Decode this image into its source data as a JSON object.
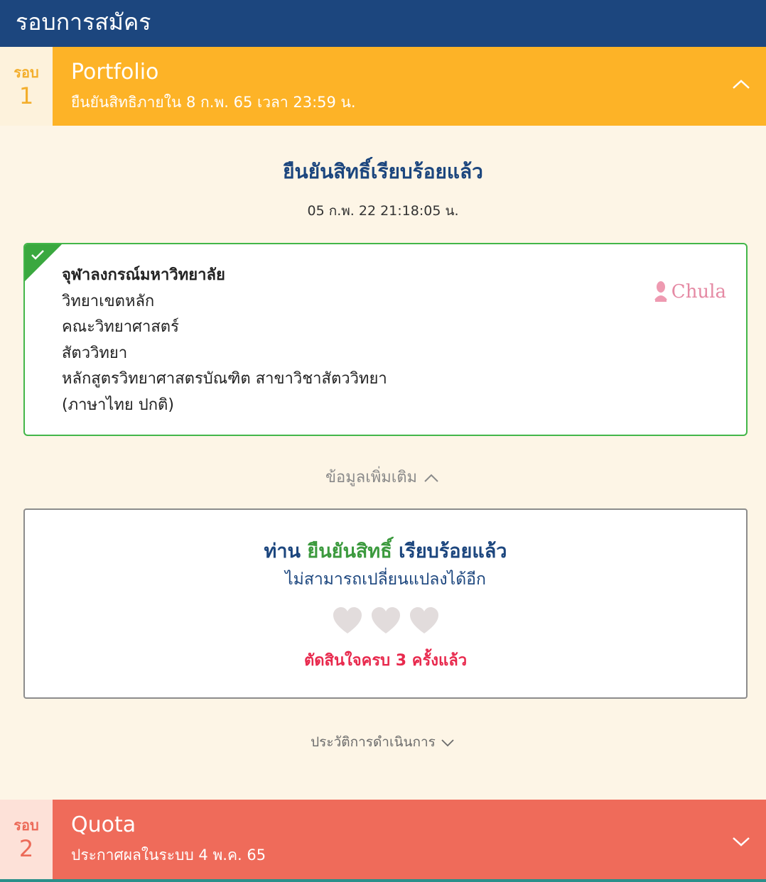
{
  "header": {
    "title": "รอบการสมัคร"
  },
  "rounds": [
    {
      "word": "รอบ",
      "number": "1",
      "name": "Portfolio",
      "subtitle": "ยืนยันสิทธิภายใน 8 ก.พ. 65 เวลา 23:59 น.",
      "state_icon": "chevron-up-icon",
      "color": "#fdb327"
    },
    {
      "word": "รอบ",
      "number": "2",
      "name": "Quota",
      "subtitle": "ประกาศผลในระบบ 4 พ.ค. 65",
      "state_icon": "chevron-down-icon",
      "color": "#ef6b5a"
    }
  ],
  "confirmation": {
    "title": "ยืนยันสิทธิ์เรียบร้อยแล้ว",
    "timestamp": "05 ก.พ. 22 21:18:05 น."
  },
  "choice": {
    "university": "จุฬาลงกรณ์มหาวิทยาลัย",
    "campus": "วิทยาเขตหลัก",
    "faculty": "คณะวิทยาศาสตร์",
    "department": "สัตววิทยา",
    "program": "หลักสูตรวิทยาศาสตรบัณฑิต สาขาวิชาสัตววิทยา",
    "program_type": "(ภาษาไทย ปกติ)",
    "logo_text": "Chula"
  },
  "more_info": {
    "label": "ข้อมูลเพิ่มเติม"
  },
  "status": {
    "prefix": "ท่าน",
    "highlight": "ยืนยันสิทธิ์",
    "suffix": "เรียบร้อยแล้ว",
    "note": "ไม่สามารถเปลี่ยนแปลงได้อีก",
    "hearts_used": 3,
    "hearts_total": 3,
    "decisions": "ตัดสินใจครบ 3 ครั้งแล้ว"
  },
  "history": {
    "label": "ประวัติการดำเนินการ"
  },
  "colors": {
    "primary": "#1c467e",
    "accent_green": "#3c9a3e",
    "alert_red": "#e8294d",
    "background": "#fdf5e6"
  }
}
